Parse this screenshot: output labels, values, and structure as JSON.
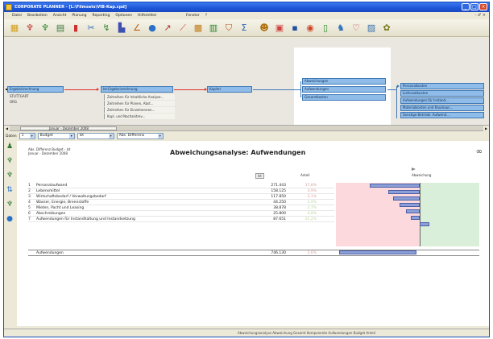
{
  "window": {
    "title": "CORPORATE PLANNER - [L:\\Filmsets\\VIB-Kap.cpd]"
  },
  "menu": {
    "items": [
      "Datei",
      "Bearbeiten",
      "Ansicht",
      "Planung",
      "Reporting",
      "Optionen",
      "Hilfsmittel",
      "Fenster",
      "?"
    ],
    "right": "- ♂ ×"
  },
  "toolbar": {
    "icons": [
      {
        "name": "report-icon",
        "glyph": "▦",
        "color": "#d4a020"
      },
      {
        "name": "tree-icon",
        "glyph": "♆",
        "color": "#c03030"
      },
      {
        "name": "tree-add-icon",
        "glyph": "♆",
        "color": "#2e8a2e"
      },
      {
        "name": "table-icon",
        "glyph": "▤",
        "color": "#3a7a3a"
      },
      {
        "name": "chart-icon",
        "glyph": "▮",
        "color": "#d03030"
      },
      {
        "name": "cut-icon",
        "glyph": "✂",
        "color": "#3070c0"
      },
      {
        "name": "link-icon",
        "glyph": "↯",
        "color": "#3a8a3a"
      },
      {
        "name": "bar-chart-icon",
        "glyph": "▙",
        "color": "#4050b0"
      },
      {
        "name": "line-chart-icon",
        "glyph": "∠",
        "color": "#c06010"
      },
      {
        "name": "globe-icon",
        "glyph": "●",
        "color": "#2a70c8"
      },
      {
        "name": "wand-icon",
        "glyph": "↗",
        "color": "#b03030"
      },
      {
        "name": "trend-icon",
        "glyph": "⟋",
        "color": "#d04040"
      },
      {
        "name": "database-icon",
        "glyph": "▩",
        "color": "#c08020"
      },
      {
        "name": "grid-icon",
        "glyph": "▥",
        "color": "#2a8a2a"
      },
      {
        "name": "filter-icon",
        "glyph": "⛉",
        "color": "#c05010"
      },
      {
        "name": "sigma-icon",
        "glyph": "Σ",
        "color": "#3060b0"
      },
      {
        "name": "users-icon",
        "glyph": "☻",
        "color": "#b07010"
      },
      {
        "name": "calendar-icon",
        "glyph": "▣",
        "color": "#d04040"
      },
      {
        "name": "save-icon",
        "glyph": "▪",
        "color": "#2050a0"
      },
      {
        "name": "stop-icon",
        "glyph": "◉",
        "color": "#d04020"
      },
      {
        "name": "document-icon",
        "glyph": "▯",
        "color": "#2a8a2a"
      },
      {
        "name": "people-icon",
        "glyph": "♞",
        "color": "#3070c0"
      },
      {
        "name": "heart-icon",
        "glyph": "♡",
        "color": "#c03040"
      },
      {
        "name": "box-icon",
        "glyph": "▨",
        "color": "#3a70b0"
      },
      {
        "name": "settings-icon",
        "glyph": "✿",
        "color": "#7a7a20"
      }
    ]
  },
  "flow": {
    "col1_box": "Ergebnisrechnung",
    "col1_items": [
      "STUTTGART",
      "ORG"
    ],
    "col2_box": "Ist-Ergebnisrechnung",
    "col2_items": [
      "Zeitreihen für Inhaltliche Analyse...",
      "Zeitreihen für Planen, Abst...",
      "Zeitreihen für Einzelnennen...",
      "Kapl. und Nachzeitrev..."
    ],
    "col3_box": "Kapitel",
    "col4_boxes": [
      "Abweichungen",
      "Aufwendungen",
      "Gesamtkosten"
    ],
    "col5_items": [
      "Personalkosten",
      "Lieferantkosten",
      "Aufwendungen für Instand...",
      "Materialkosten und Raumaus...",
      "Sonstige Betriebl. Aufwend..."
    ]
  },
  "scroll": {
    "label": "Januar - Dezember 2008"
  },
  "filter": {
    "label": "Daten",
    "period": "1",
    "mode": "Budget",
    "op": "Ist",
    "unit": "Abs. Differenz"
  },
  "report": {
    "meta": [
      "Abs. Differenz Budget - Ist",
      "Januar - Dezember 2008"
    ],
    "title": "Abweichungsanalyse: Aufwendungen",
    "headers": {
      "value": "Ist",
      "pct": "Anteil",
      "chart": "Abweichung"
    },
    "rows": [
      {
        "num": "1",
        "name": "Personalaufwand",
        "value": "271.443",
        "pct": "17,8%",
        "pct_color": "#d9a0a0"
      },
      {
        "num": "2",
        "name": "Lebensmittel",
        "value": "158.125",
        "pct": "3,9%",
        "pct_color": "#d9a0a0"
      },
      {
        "num": "3",
        "name": "Wirtschaftsbedarf / Verwaltungsbedarf",
        "value": "117.850",
        "pct": "3,1%",
        "pct_color": "#d9a0a0"
      },
      {
        "num": "4",
        "name": "Wasser, Energie, Brennstoffe",
        "value": "44.250",
        "pct": "2,4%",
        "pct_color": "#b8d89a"
      },
      {
        "num": "5",
        "name": "Mieten, Pacht und Leasing",
        "value": "38.878",
        "pct": "2,7%",
        "pct_color": "#b8d89a"
      },
      {
        "num": "6",
        "name": "Abschreibungen",
        "value": "25.800",
        "pct": "0,8%",
        "pct_color": "#b8d89a"
      },
      {
        "num": "7",
        "name": "Aufwendungen für Instandhaltung und Instandsetzung",
        "value": "87.651",
        "pct": "22,2%",
        "pct_color": "#b8d89a"
      }
    ],
    "bar_values": [
      -0.62,
      -0.39,
      -0.33,
      -0.25,
      -0.17,
      -0.11,
      0.12
    ],
    "sum": {
      "name": "Aufwendungen",
      "value": "746.130",
      "pct": "5,6%"
    }
  },
  "status": {
    "text": "Abweichungsanalyse   Abweichung   Gesamt   Komponente   Aufwendungen   Budget   Anteil"
  }
}
